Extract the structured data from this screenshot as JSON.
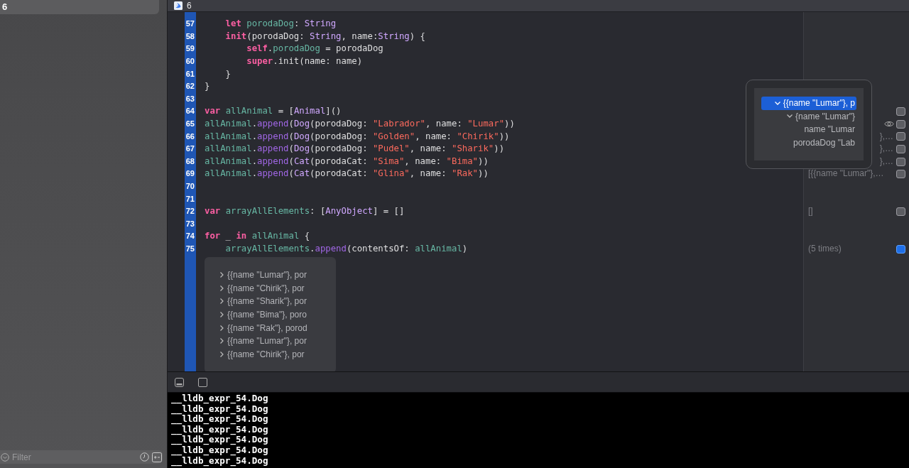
{
  "sidebar": {
    "items": [
      {
        "label": "6",
        "selected": true
      }
    ],
    "filter": {
      "placeholder": "Filter"
    }
  },
  "editor_tab": {
    "title": "6"
  },
  "code_lines": [
    {
      "number": "57",
      "segments": [
        {
          "kind": "kw",
          "text": "    let "
        },
        {
          "kind": "proj",
          "text": "porodaDog"
        },
        {
          "kind": "plain",
          "text": ": "
        },
        {
          "kind": "type",
          "text": "String"
        }
      ]
    },
    {
      "number": "58",
      "segments": [
        {
          "kind": "kw",
          "text": "    init"
        },
        {
          "kind": "plain",
          "text": "(porodaDog: "
        },
        {
          "kind": "type",
          "text": "String"
        },
        {
          "kind": "plain",
          "text": ", name:"
        },
        {
          "kind": "type",
          "text": "String"
        },
        {
          "kind": "plain",
          "text": ") {"
        }
      ]
    },
    {
      "number": "59",
      "segments": [
        {
          "kind": "kw",
          "text": "        self"
        },
        {
          "kind": "plain",
          "text": "."
        },
        {
          "kind": "proj",
          "text": "porodaDog"
        },
        {
          "kind": "plain",
          "text": " = porodaDog"
        }
      ]
    },
    {
      "number": "60",
      "segments": [
        {
          "kind": "kw",
          "text": "        super"
        },
        {
          "kind": "plain",
          "text": ".init(name: name)"
        }
      ]
    },
    {
      "number": "61",
      "segments": [
        {
          "kind": "plain",
          "text": "    }"
        }
      ]
    },
    {
      "number": "62",
      "segments": [
        {
          "kind": "plain",
          "text": "}"
        }
      ]
    },
    {
      "number": "63"
    },
    {
      "number": "64",
      "segments": [
        {
          "kind": "kw",
          "text": "var "
        },
        {
          "kind": "proj",
          "text": "allAnimal"
        },
        {
          "kind": "plain",
          "text": " = ["
        },
        {
          "kind": "type",
          "text": "Animal"
        },
        {
          "kind": "plain",
          "text": "]()"
        }
      ],
      "quick_look": {
        "selected": false
      }
    },
    {
      "number": "65",
      "segments": [
        {
          "kind": "proj",
          "text": "allAnimal"
        },
        {
          "kind": "plain",
          "text": "."
        },
        {
          "kind": "sys",
          "text": "append"
        },
        {
          "kind": "plain",
          "text": "("
        },
        {
          "kind": "type",
          "text": "Dog"
        },
        {
          "kind": "plain",
          "text": "(porodaDog: "
        },
        {
          "kind": "str",
          "text": "\"Labrador\""
        },
        {
          "kind": "plain",
          "text": ", name: "
        },
        {
          "kind": "str",
          "text": "\"Lumar\""
        },
        {
          "kind": "plain",
          "text": "))"
        }
      ],
      "quick_look": {
        "selected": false
      },
      "preview_shown": true
    },
    {
      "number": "66",
      "segments": [
        {
          "kind": "proj",
          "text": "allAnimal"
        },
        {
          "kind": "plain",
          "text": "."
        },
        {
          "kind": "sys",
          "text": "append"
        },
        {
          "kind": "plain",
          "text": "("
        },
        {
          "kind": "type",
          "text": "Dog"
        },
        {
          "kind": "plain",
          "text": "(porodaDog: "
        },
        {
          "kind": "str",
          "text": "\"Golden\""
        },
        {
          "kind": "plain",
          "text": ", name: "
        },
        {
          "kind": "str",
          "text": "\"Chirik\""
        },
        {
          "kind": "plain",
          "text": "))"
        }
      ],
      "result": {
        "text": "},…",
        "kind": "partial"
      },
      "quick_look": {
        "selected": false
      }
    },
    {
      "number": "67",
      "segments": [
        {
          "kind": "proj",
          "text": "allAnimal"
        },
        {
          "kind": "plain",
          "text": "."
        },
        {
          "kind": "sys",
          "text": "append"
        },
        {
          "kind": "plain",
          "text": "("
        },
        {
          "kind": "type",
          "text": "Dog"
        },
        {
          "kind": "plain",
          "text": "(porodaDog: "
        },
        {
          "kind": "str",
          "text": "\"Pudel\""
        },
        {
          "kind": "plain",
          "text": ", name: "
        },
        {
          "kind": "str",
          "text": "\"Sharik\""
        },
        {
          "kind": "plain",
          "text": "))"
        }
      ],
      "result": {
        "text": "},…",
        "kind": "partial"
      },
      "quick_look": {
        "selected": false
      }
    },
    {
      "number": "68",
      "segments": [
        {
          "kind": "proj",
          "text": "allAnimal"
        },
        {
          "kind": "plain",
          "text": "."
        },
        {
          "kind": "sys",
          "text": "append"
        },
        {
          "kind": "plain",
          "text": "("
        },
        {
          "kind": "type",
          "text": "Cat"
        },
        {
          "kind": "plain",
          "text": "(porodaCat: "
        },
        {
          "kind": "str",
          "text": "\"Sima\""
        },
        {
          "kind": "plain",
          "text": ", name: "
        },
        {
          "kind": "str",
          "text": "\"Bima\""
        },
        {
          "kind": "plain",
          "text": "))"
        }
      ],
      "result": {
        "text": "},…",
        "kind": "partial"
      },
      "quick_look": {
        "selected": false
      }
    },
    {
      "number": "69",
      "segments": [
        {
          "kind": "proj",
          "text": "allAnimal"
        },
        {
          "kind": "plain",
          "text": "."
        },
        {
          "kind": "sys",
          "text": "append"
        },
        {
          "kind": "plain",
          "text": "("
        },
        {
          "kind": "type",
          "text": "Cat"
        },
        {
          "kind": "plain",
          "text": "(porodaCat: "
        },
        {
          "kind": "str",
          "text": "\"Glina\""
        },
        {
          "kind": "plain",
          "text": ", name: "
        },
        {
          "kind": "str",
          "text": "\"Rak\""
        },
        {
          "kind": "plain",
          "text": "))"
        }
      ],
      "result": {
        "text": "[{{name \"Lumar\"},…",
        "kind": "full"
      },
      "quick_look": {
        "selected": false
      }
    },
    {
      "number": "70"
    },
    {
      "number": "71"
    },
    {
      "number": "72",
      "segments": [
        {
          "kind": "kw",
          "text": "var "
        },
        {
          "kind": "proj",
          "text": "arrayAllElements"
        },
        {
          "kind": "plain",
          "text": ": ["
        },
        {
          "kind": "type",
          "text": "AnyObject"
        },
        {
          "kind": "plain",
          "text": "] = []"
        }
      ],
      "result": {
        "text": "[]",
        "kind": "full"
      },
      "quick_look": {
        "selected": false
      }
    },
    {
      "number": "73"
    },
    {
      "number": "74",
      "segments": [
        {
          "kind": "kw",
          "text": "for"
        },
        {
          "kind": "plain",
          "text": " _ "
        },
        {
          "kind": "kw",
          "text": "in "
        },
        {
          "kind": "proj",
          "text": "allAnimal"
        },
        {
          "kind": "plain",
          "text": " {"
        }
      ]
    },
    {
      "number": "75",
      "segments": [
        {
          "kind": "proj",
          "text": "    arrayAllElements"
        },
        {
          "kind": "plain",
          "text": "."
        },
        {
          "kind": "sys",
          "text": "append"
        },
        {
          "kind": "plain",
          "text": "(contentsOf: "
        },
        {
          "kind": "proj",
          "text": "allAnimal"
        },
        {
          "kind": "plain",
          "text": ")"
        }
      ],
      "result": {
        "text": "(5 times)",
        "kind": "full"
      },
      "quick_look": {
        "selected": true
      }
    }
  ],
  "inline_result": {
    "items": [
      {
        "label": "{{name \"Lumar\"}, por",
        "expanded": false
      },
      {
        "label": "{{name \"Chirik\"}, por",
        "expanded": false
      },
      {
        "label": "{{name \"Sharik\"}, por",
        "expanded": false
      },
      {
        "label": "{{name \"Bima\"}, poro",
        "expanded": false
      },
      {
        "label": "{{name \"Rak\"}, porod",
        "expanded": false
      },
      {
        "label": "{{name \"Lumar\"}, por",
        "expanded": false
      },
      {
        "label": "{{name \"Chirik\"}, por",
        "expanded": false
      }
    ]
  },
  "quick_look_popover": {
    "rows": [
      {
        "label": "{{name \"Lumar\"}, p",
        "expanded": true,
        "selected": true,
        "children": [
          {
            "label": "{name \"Lumar\"}",
            "expanded": true,
            "selected": false,
            "children": [
              {
                "label": "name \"Lumar",
                "selected": false
              },
              {
                "label": "porodaDog \"Lab",
                "selected": false
              }
            ]
          }
        ]
      }
    ]
  },
  "console": {
    "lines": [
      "__lldb_expr_54.Dog",
      "__lldb_expr_54.Dog",
      "__lldb_expr_54.Dog",
      "__lldb_expr_54.Dog",
      "__lldb_expr_54.Dog",
      "__lldb_expr_54.Dog",
      "__lldb_expr_54.Dog"
    ]
  }
}
